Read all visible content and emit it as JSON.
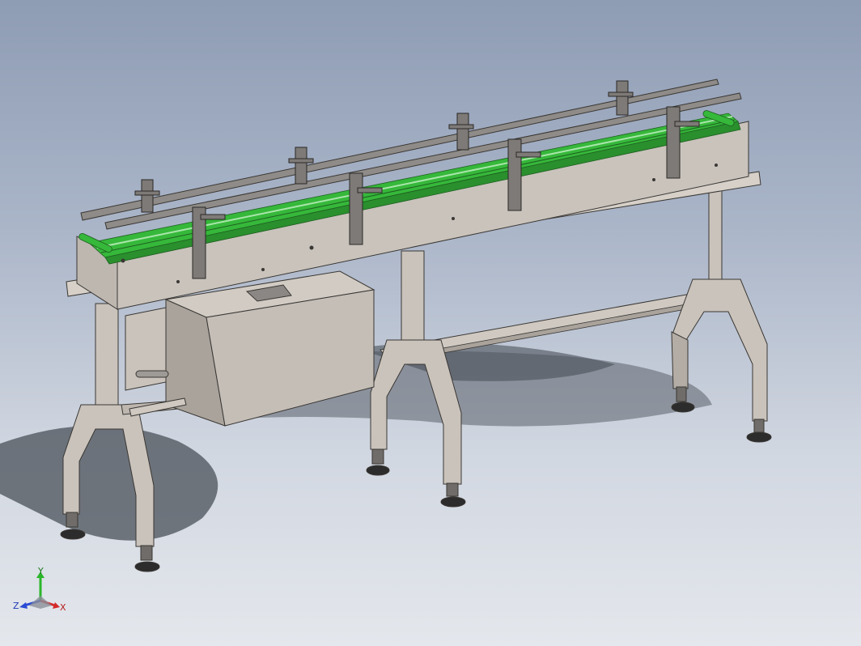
{
  "viewport": {
    "background_top": "#8e9cb4",
    "background_bottom": "#e4e7ec"
  },
  "model": {
    "frame_color": "#c9c3bc",
    "frame_edge_color": "#3a3733",
    "belt_color": "#36b83a",
    "belt_dark_color": "#2a8f2d",
    "guide_color": "#8e8b88",
    "shadow_color": "#4a5058"
  },
  "triad": {
    "y_label": "Y",
    "x_label": "X",
    "z_label": "Z",
    "x_color": "#d42a2a",
    "y_color": "#2ab52a",
    "z_color": "#2a4bd4"
  }
}
